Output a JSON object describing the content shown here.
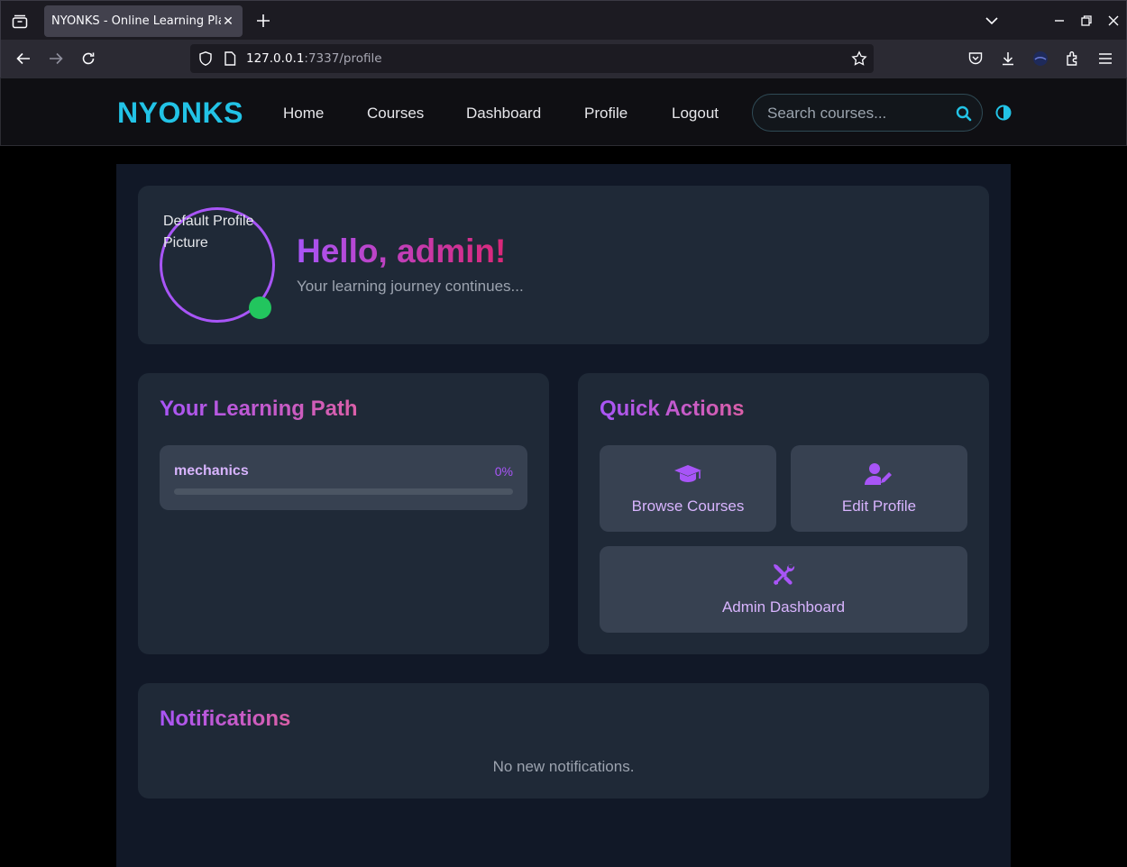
{
  "browser": {
    "tab_title": "NYONKS - Online Learning Platform",
    "url_host": "127.0.0.1",
    "url_rest": ":7337/profile"
  },
  "site": {
    "logo": "NYONKS",
    "nav": [
      "Home",
      "Courses",
      "Dashboard",
      "Profile",
      "Logout"
    ],
    "search_placeholder": "Search courses..."
  },
  "profile": {
    "avatar_alt": "Default Profile Picture",
    "greeting": "Hello, admin!",
    "subtitle": "Your learning journey continues..."
  },
  "learning_path": {
    "title": "Your Learning Path",
    "courses": [
      {
        "name": "mechanics",
        "progress_label": "0%",
        "progress": 0
      }
    ]
  },
  "quick_actions": {
    "title": "Quick Actions",
    "items": [
      {
        "label": "Browse Courses",
        "icon": "graduation-cap-icon"
      },
      {
        "label": "Edit Profile",
        "icon": "user-edit-icon"
      },
      {
        "label": "Admin Dashboard",
        "icon": "tools-icon"
      }
    ]
  },
  "notifications": {
    "title": "Notifications",
    "empty_text": "No new notifications."
  },
  "colors": {
    "accent": "#a855f7",
    "logo": "#22c3e6",
    "status_online": "#22c55e"
  }
}
